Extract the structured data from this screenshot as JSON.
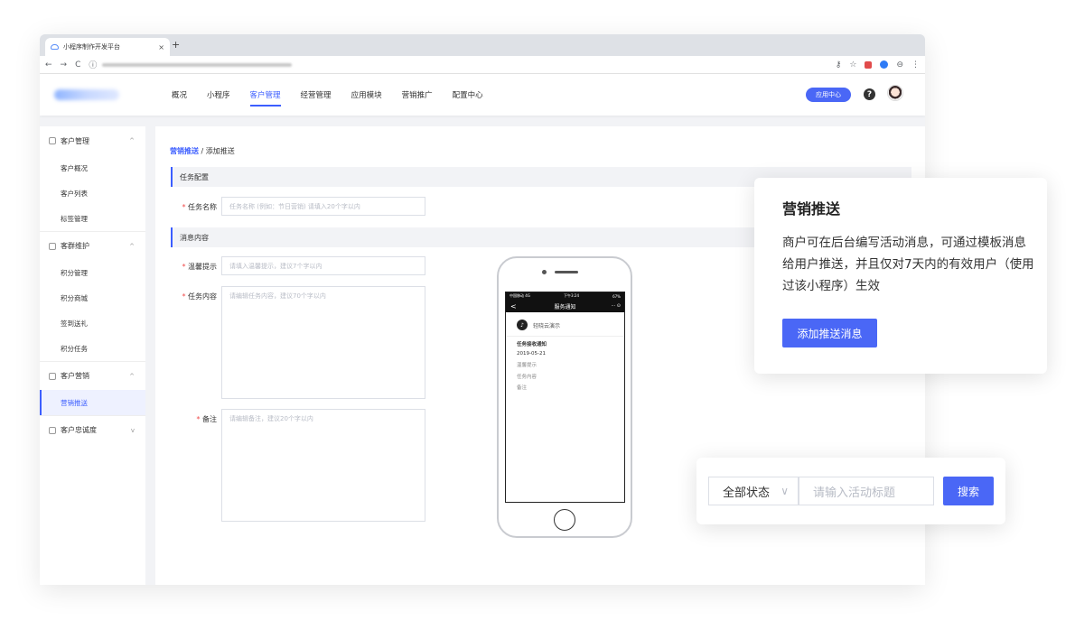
{
  "browser": {
    "tab_title": "小程序制作开发平台",
    "tab_close": "×",
    "new_tab": "+",
    "nav_back": "←",
    "nav_forward": "→",
    "reload": "C",
    "info": "ⓘ",
    "ext_key": "⚷",
    "ext_star": "☆",
    "ext_account": "⊖",
    "ext_menu": "⋮"
  },
  "header": {
    "nav": [
      "概况",
      "小程序",
      "客户管理",
      "经营管理",
      "应用模块",
      "营销推广",
      "配置中心"
    ],
    "active_nav": "客户管理",
    "app_center": "应用中心",
    "help": "?"
  },
  "sidebar": {
    "groups": [
      {
        "label": "客户管理",
        "items": [
          "客户概况",
          "客户列表",
          "标签管理"
        ],
        "chevron": "^"
      },
      {
        "label": "客群维护",
        "items": [
          "积分管理",
          "积分商城",
          "签到送礼",
          "积分任务"
        ],
        "chevron": "^"
      },
      {
        "label": "客户营销",
        "items": [
          "营销推送"
        ],
        "chevron": "^"
      },
      {
        "label": "客户忠诚度",
        "items": [],
        "chevron": "v"
      }
    ],
    "active_item": "营销推送"
  },
  "main": {
    "breadcrumb_link": "营销推送",
    "breadcrumb_sep": "/",
    "breadcrumb_current": "添加推送",
    "section1": "任务配置",
    "section2": "消息内容",
    "required_mark": "*",
    "fields": {
      "task_name_label": "任务名称",
      "task_name_placeholder": "任务名称 (例如：节日营销) 请填入20个字以内",
      "tip_label": "温馨提示",
      "tip_placeholder": "请填入温馨提示，建议7个字以内",
      "content_label": "任务内容",
      "content_placeholder": "请编辑任务内容，建议70个字以内",
      "remark_label": "备注",
      "remark_placeholder": "请编辑备注，建议20个字以内"
    }
  },
  "phone": {
    "status_left": "中国移动 4G",
    "status_center": "下午3:24",
    "status_right": "67%",
    "back": "<",
    "title": "服务通知",
    "caps": "··· ⊙",
    "sender": "轻晓云演示",
    "sender_icon": "♪",
    "notice_title": "任务接收通知",
    "notice_date": "2019-05-21",
    "lines": [
      "温馨提示",
      "任务内容",
      "备注"
    ]
  },
  "promo_card": {
    "title": "营销推送",
    "desc": "商户可在后台编写活动消息，可通过模板消息给用户推送，并且仅对7天内的有效用户（使用过该小程序）生效",
    "button": "添加推送消息"
  },
  "search_card": {
    "select_value": "全部状态",
    "select_chevron": "∨",
    "input_placeholder": "请输入活动标题",
    "button": "搜索"
  },
  "colors": {
    "accent": "#4a67f6",
    "required": "#f04b4b"
  }
}
